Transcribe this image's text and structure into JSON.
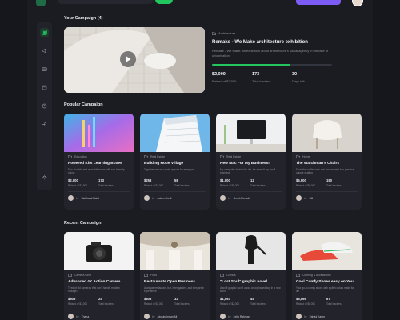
{
  "featured_section": {
    "title": "Your Campaign (4)",
    "category": "Architecture",
    "campaign_title": "Remake - We Make architecture exhibition",
    "description": "Remake - We Make: an exhibition about architecture's social agency in the face of urbanisation",
    "progress_fraction": 0.65,
    "stats": [
      {
        "value": "$2,000",
        "label": "Raised of $2,500"
      },
      {
        "value": "173",
        "label": "Total backers"
      },
      {
        "value": "30",
        "label": "Days left"
      }
    ]
  },
  "popular_section": {
    "title": "Popular Campaign",
    "cards": [
      {
        "category": "Education",
        "title": "Powered Kits Learning Boxes",
        "desc": "Fun, durable and reusable boxes with eco-friendly colors",
        "raised": "$2,000",
        "raised_label": "Raised of $1,900",
        "backers": "173",
        "backers_label": "Total backers",
        "by": "by",
        "author": "Mahfuzul Nabil"
      },
      {
        "category": "Real Estate",
        "title": "Building Hope Village",
        "desc": "Together we can create spaces for everyone",
        "raised": "$253",
        "raised_label": "Raised of $1,000",
        "backers": "58",
        "backers_label": "Total backers",
        "by": "by",
        "author": "Adam Orellt"
      },
      {
        "category": "Real Estate",
        "title": "New Mac For My Business!",
        "desc": "My computer decided to die, be a result my small business",
        "raised": "$1,000",
        "raised_label": "Raised of $5,000",
        "backers": "12",
        "backers_label": "Total backers",
        "by": "by",
        "author": "Omid Ahmadi"
      },
      {
        "category": "Home",
        "title": "The Watchman's Chairs",
        "desc": "From the crafted arm-rest and armrest into practical unique seating",
        "raised": "$5,900",
        "raised_label": "Raised of $6,000",
        "backers": "190",
        "backers_label": "Total backers",
        "by": "by",
        "author": "Bill"
      }
    ]
  },
  "recent_section": {
    "title": "Recent Campaign",
    "cards": [
      {
        "category": "Camera Gear",
        "title": "Advanced 4K Action Camera",
        "desc": "Tired of old cameras that don't handle modern footage?",
        "raised": "$606",
        "raised_label": "Raised of $1,000",
        "backers": "24",
        "backers_label": "Total backers",
        "by": "by",
        "author": "Thana"
      },
      {
        "category": "Food",
        "title": "Restaurants Open Business",
        "desc": "A unique restaurant, bar, beer garden, and biergarten experience",
        "raised": "$803",
        "raised_label": "Raised of $1,000",
        "backers": "32",
        "backers_label": "Total backers",
        "by": "by",
        "author": "Abdulrahman Ali"
      },
      {
        "category": "Comics",
        "title": "\"Lost Soul\" graphic novel",
        "desc": "A sci-fi graphic novel about an orphaned boy in a new world",
        "raised": "$1,093",
        "raised_label": "Raised of $2,000",
        "backers": "45",
        "backers_label": "Total backers",
        "by": "by",
        "author": "Leila Rahman"
      },
      {
        "category": "Clothing & Accessories",
        "title": "Cool Comfy Shoes easy on You",
        "desc": "Your go-to comfy shoes with stylish colors made for life",
        "raised": "$5,866",
        "raised_label": "Raised of $6,000",
        "backers": "67",
        "backers_label": "Total backers",
        "by": "by",
        "author": "Fahad Karim"
      }
    ]
  },
  "colors": {
    "accent": "#22c55e",
    "brand": "#7c5cf5",
    "background": "#1b1c22"
  },
  "sidebar_icons": [
    "dashboard-icon",
    "campaign-icon",
    "payment-icon",
    "withdraw-icon",
    "profile-icon",
    "logout-icon",
    "theme-icon"
  ]
}
